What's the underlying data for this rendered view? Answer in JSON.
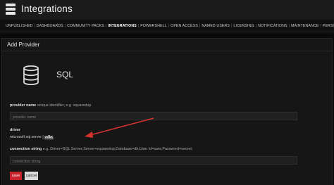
{
  "header": {
    "title": "Integrations",
    "icon": "server-icon"
  },
  "nav": {
    "tabs": [
      {
        "label": "UNPUBLISHED",
        "active": false
      },
      {
        "label": "DASHBOARDS",
        "active": false
      },
      {
        "label": "COMMUNITY PACKS",
        "active": false
      },
      {
        "label": "INTEGRATIONS",
        "active": true
      },
      {
        "label": "POWERSHELL",
        "active": false
      },
      {
        "label": "OPEN ACCESS",
        "active": false
      },
      {
        "label": "NAMED USERS",
        "active": false
      },
      {
        "label": "LICENSING",
        "active": false
      },
      {
        "label": "NOTIFICATIONS",
        "active": false
      },
      {
        "label": "MAINTENANCE",
        "active": false
      },
      {
        "label": "PERSONALIZATION",
        "active": false
      }
    ],
    "separator": "|"
  },
  "panel": {
    "title": "Add Provider",
    "provider_icon": "database-icon",
    "provider_name": "SQL"
  },
  "form": {
    "provider_name": {
      "label": "provider name",
      "hint": "unique identifier, e.g. squaredup",
      "placeholder": "provider name"
    },
    "driver": {
      "label": "driver",
      "options": [
        "microsoft sql server",
        "odbc"
      ],
      "selected": "odbc",
      "separator": "|"
    },
    "connection_string": {
      "label": "connection string",
      "hint": "e.g. Driver=SQL Server;Server=squaredup;Database=db;User Id=user;Password=secret;",
      "placeholder": "connection string"
    }
  },
  "actions": {
    "save_label": "save",
    "cancel_label": "cancel"
  },
  "colors": {
    "accent": "#c8232c",
    "annotation_arrow": "#d6332e"
  }
}
